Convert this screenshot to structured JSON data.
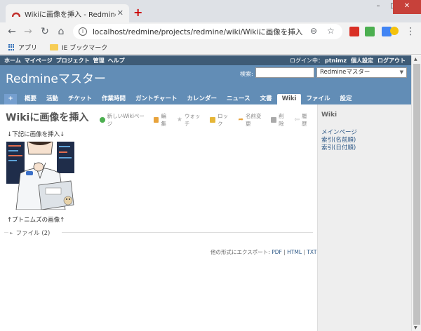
{
  "browser": {
    "tab_title": "Wikiに画像を挿入 - Redmineマス",
    "url": "localhost/redmine/projects/redmine/wiki/Wikiに画像を挿入",
    "bookmarks": [
      "アプリ",
      "IE ブックマーク"
    ]
  },
  "topmenu": {
    "items": [
      "ホーム",
      "マイページ",
      "プロジェクト",
      "管理",
      "ヘルプ"
    ],
    "login_label": "ログイン中：",
    "user": "ptnimz",
    "my_account": "個人設定",
    "logout": "ログアウト"
  },
  "header": {
    "title": "Redmineマスター",
    "search_label": "検索:",
    "project_select": "Redmineマスター"
  },
  "mainmenu": {
    "new": "+",
    "items": [
      "概要",
      "活動",
      "チケット",
      "作業時間",
      "ガントチャート",
      "カレンダー",
      "ニュース",
      "文書",
      "Wiki",
      "ファイル",
      "設定"
    ],
    "selected": "Wiki"
  },
  "content": {
    "title": "Wikiに画像を挿入",
    "actions": [
      "新しいWikiページ",
      "編集",
      "ウォッチ",
      "ロック",
      "名前変更",
      "削除",
      "履歴"
    ],
    "text_before": "↓下記に画像を挿入↓",
    "text_after": "↑プトニムズの画像↑",
    "files": "ファイル (2)",
    "export_label": "他の形式にエクスポート:",
    "export_links": [
      "PDF",
      "HTML",
      "TXT"
    ]
  },
  "sidebar": {
    "title": "Wiki",
    "links": [
      "メインページ",
      "索引(名前順)",
      "索引(日付順)"
    ]
  },
  "colors": {
    "header": "#628db6",
    "topmenu": "#3e5b76",
    "link": "#2a5685"
  }
}
